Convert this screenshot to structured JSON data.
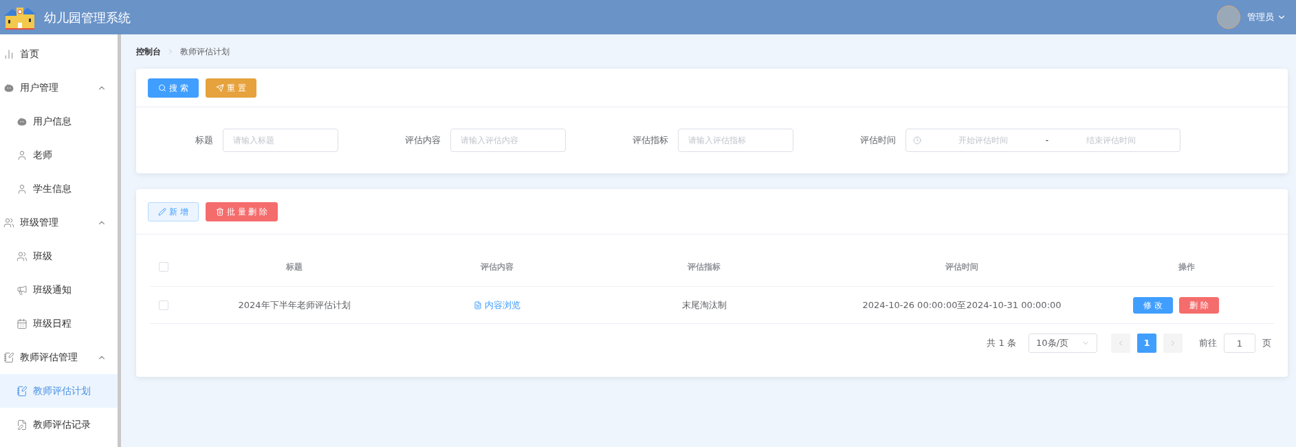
{
  "header": {
    "title": "幼儿园管理系统",
    "user": "管理员"
  },
  "sidebar": {
    "items": [
      {
        "label": "首页",
        "selected": false
      },
      {
        "label": "用户管理",
        "expanded": true,
        "selected": false,
        "children": [
          {
            "label": "用户信息",
            "selected": false
          },
          {
            "label": "老师",
            "selected": false
          },
          {
            "label": "学生信息",
            "selected": false
          }
        ]
      },
      {
        "label": "班级管理",
        "expanded": true,
        "selected": false,
        "children": [
          {
            "label": "班级",
            "selected": false
          },
          {
            "label": "班级通知",
            "selected": false
          },
          {
            "label": "班级日程",
            "selected": false
          }
        ]
      },
      {
        "label": "教师评估管理",
        "expanded": true,
        "selected": false,
        "children": [
          {
            "label": "教师评估计划",
            "selected": true
          },
          {
            "label": "教师评估记录",
            "selected": false
          }
        ]
      }
    ]
  },
  "breadcrumb": [
    "控制台",
    "教师评估计划"
  ],
  "search_panel": {
    "buttons": [
      {
        "kind": "search",
        "label": "搜 索"
      },
      {
        "kind": "reset",
        "label": "重 置"
      }
    ],
    "fields": [
      {
        "kind": "text",
        "label": "标题",
        "placeholder": "请输入标题"
      },
      {
        "kind": "text",
        "label": "评估内容",
        "placeholder": "请输入评估内容"
      },
      {
        "kind": "text",
        "label": "评估指标",
        "placeholder": "请输入评估指标"
      },
      {
        "kind": "range",
        "label": "评估时间",
        "start_placeholder": "开始评估时间",
        "separator": "-",
        "end_placeholder": "结束评估时间"
      }
    ]
  },
  "table_panel": {
    "buttons": [
      {
        "kind": "add",
        "label": "新 增"
      },
      {
        "kind": "delete",
        "label": "批 量 删 除"
      }
    ],
    "columns": [
      "标题",
      "评估内容",
      "评估指标",
      "评估时间",
      "操作"
    ],
    "header_checked": false,
    "rows": [
      {
        "checked": false,
        "title": "2024年下半年老师评估计划",
        "content_link": "内容浏览",
        "indicator": "末尾淘汰制",
        "time": "2024-10-26 00:00:00至2024-10-31 00:00:00",
        "actions": [
          {
            "kind": "edit",
            "label": "修 改"
          },
          {
            "kind": "delete",
            "label": "删 除"
          }
        ]
      }
    ],
    "pagination": {
      "total": "共 1 条",
      "page_size": "10条/页",
      "pages": [
        {
          "label": "1",
          "selected": true
        }
      ],
      "goto_label": "前往",
      "goto_value": "1",
      "goto_suffix": "页"
    }
  }
}
